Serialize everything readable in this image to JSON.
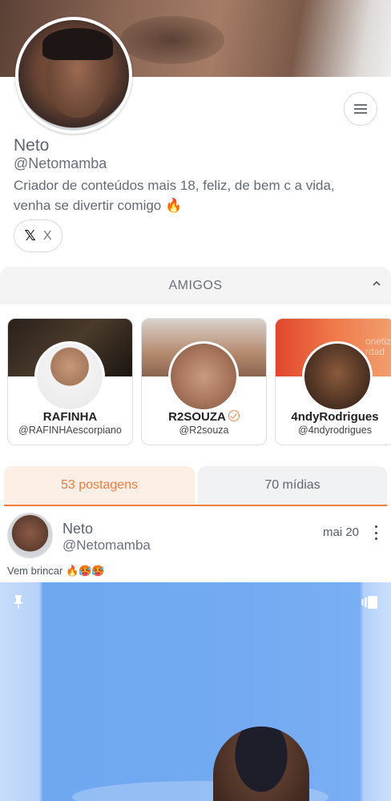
{
  "profile": {
    "name": "Neto",
    "handle": "@Netomamba",
    "bio": "Criador de conteúdos mais 18, feliz, de bem c a vida, venha se divertir comigo 🔥",
    "social_x_label": "X"
  },
  "friends": {
    "title": "AMIGOS",
    "items": [
      {
        "name": "RAFINHA",
        "handle": "@RAFINHAescorpiano",
        "verified": false
      },
      {
        "name": "R2SOUZA",
        "handle": "@R2souza",
        "verified": true
      },
      {
        "name": "4ndyRodrigues",
        "handle": "@4ndyrodrigues",
        "verified": false
      }
    ],
    "banner3_text": "onetiz\nrdad"
  },
  "tabs": [
    {
      "label": "53 postagens",
      "active": true
    },
    {
      "label": "70 mídias",
      "active": false
    }
  ],
  "post": {
    "author_name": "Neto",
    "author_handle": "@Netomamba",
    "date": "mai 20",
    "caption": "Vem brincar 🔥🥵🥵"
  },
  "colors": {
    "accent": "#f07c3c",
    "active_tab_bg": "#fdeee6",
    "verified": "#f08a4b"
  },
  "icons": {
    "menu": "hamburger-icon",
    "x_logo": "x-logo-icon",
    "chevron": "chevron-up-icon",
    "verified": "verified-check-icon",
    "more": "kebab-menu-icon",
    "pin": "pin-icon",
    "gallery": "gallery-icon"
  }
}
